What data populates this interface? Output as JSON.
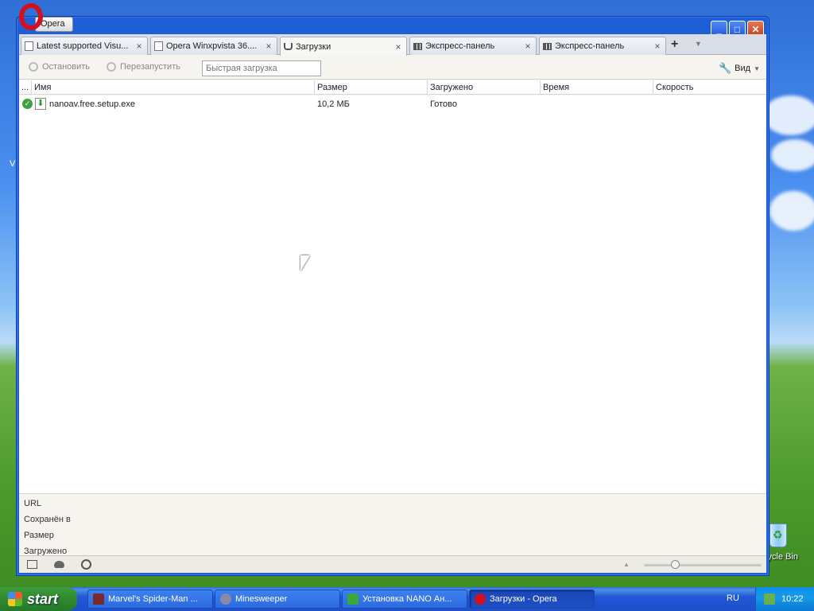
{
  "desktop": {
    "recycle_bin_label": "cycle Bin",
    "left_edge_text": "V"
  },
  "window": {
    "app_button": "Opera",
    "controls": {
      "minimize": "_",
      "maximize": "□",
      "close": "✕"
    }
  },
  "tabs": [
    {
      "label": "Latest supported Visu...",
      "icon": "page-icon",
      "close": "×"
    },
    {
      "label": "Opera Winxpvista 36....",
      "icon": "page-icon",
      "close": "×"
    },
    {
      "label": "Загрузки",
      "icon": "downloads-icon",
      "close": "×",
      "active": true
    },
    {
      "label": "Экспресс-панель",
      "icon": "speed-dial-icon",
      "close": "×"
    },
    {
      "label": "Экспресс-панель",
      "icon": "speed-dial-icon",
      "close": "×"
    }
  ],
  "tabbar": {
    "new_tab": "+",
    "tab_menu": "▼"
  },
  "toolbar": {
    "stop_label": "Остановить",
    "restart_label": "Перезапустить",
    "quick_download_placeholder": "Быстрая загрузка",
    "view_label": "Вид"
  },
  "columns": {
    "dots": "...",
    "name": "Имя",
    "size": "Размер",
    "downloaded": "Загружено",
    "time": "Время",
    "speed": "Скорость"
  },
  "downloads": [
    {
      "name": "nanoav.free.setup.exe",
      "size": "10,2 МБ",
      "downloaded": "Готово",
      "time": "",
      "speed": ""
    }
  ],
  "details": {
    "url_label": "URL",
    "saved_to_label": "Сохранён в",
    "size_label": "Размер",
    "downloaded_label": "Загружено"
  },
  "taskbar": {
    "start_label": "start",
    "tasks": [
      {
        "label": "Marvel's Spider-Man ..."
      },
      {
        "label": "Minesweeper"
      },
      {
        "label": "Установка NANO Ан..."
      },
      {
        "label": "Загрузки - Opera",
        "active": true
      }
    ],
    "language": "RU",
    "clock": "10:22"
  },
  "colors": {
    "window_frame": "#1f5fd6",
    "close_button": "#c1401a",
    "status_ok": "#3ea13e",
    "taskbar": "#2157d7",
    "start_button": "#2f8a2f"
  }
}
